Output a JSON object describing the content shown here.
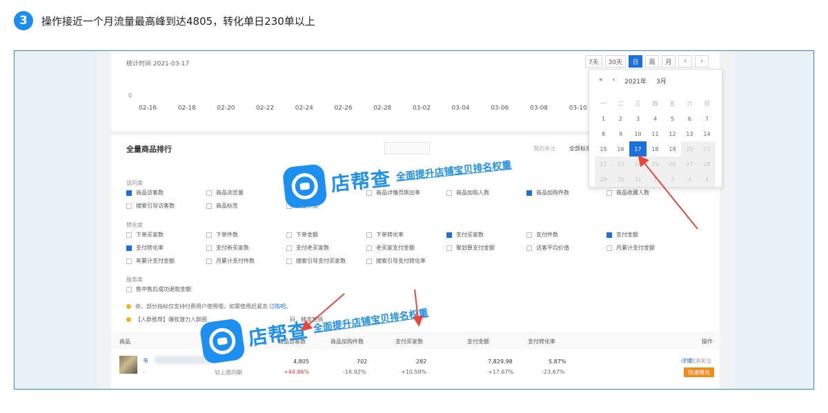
{
  "step": {
    "number": "3",
    "text": "操作接近一个月流量最高峰到达4805，转化单日230单以上"
  },
  "stats": {
    "time_label": "统计时间 2021-03-17",
    "range_buttons": [
      "7天",
      "30天",
      "日",
      "周",
      "月"
    ],
    "active_range": "日",
    "prev_icon": "‹",
    "next_icon": "›",
    "chart_zero": "0",
    "x_axis": [
      "02-16",
      "02-18",
      "02-20",
      "02-22",
      "02-24",
      "02-26",
      "02-28",
      "03-02",
      "03-04",
      "03-06",
      "03-08",
      "03-10"
    ]
  },
  "calendar": {
    "prev_year": "«",
    "prev_month": "‹",
    "year": "2021年",
    "month": "3月",
    "weekdays": [
      "一",
      "二",
      "三",
      "四",
      "五",
      "六",
      "日"
    ],
    "days": [
      {
        "d": "1",
        "s": ""
      },
      {
        "d": "2",
        "s": ""
      },
      {
        "d": "3",
        "s": ""
      },
      {
        "d": "4",
        "s": ""
      },
      {
        "d": "5",
        "s": ""
      },
      {
        "d": "6",
        "s": ""
      },
      {
        "d": "7",
        "s": ""
      },
      {
        "d": "8",
        "s": ""
      },
      {
        "d": "9",
        "s": ""
      },
      {
        "d": "10",
        "s": ""
      },
      {
        "d": "11",
        "s": ""
      },
      {
        "d": "12",
        "s": ""
      },
      {
        "d": "13",
        "s": ""
      },
      {
        "d": "14",
        "s": ""
      },
      {
        "d": "15",
        "s": ""
      },
      {
        "d": "16",
        "s": ""
      },
      {
        "d": "17",
        "s": "sel"
      },
      {
        "d": "18",
        "s": ""
      },
      {
        "d": "19",
        "s": ""
      },
      {
        "d": "20",
        "s": "dis"
      },
      {
        "d": "21",
        "s": "dis"
      },
      {
        "d": "22",
        "s": "dis"
      },
      {
        "d": "23",
        "s": "dis"
      },
      {
        "d": "24",
        "s": "dis"
      },
      {
        "d": "25",
        "s": "dis"
      },
      {
        "d": "26",
        "s": "dis"
      },
      {
        "d": "27",
        "s": "dis"
      },
      {
        "d": "28",
        "s": "dis"
      },
      {
        "d": "29",
        "s": "dis"
      },
      {
        "d": "30",
        "s": "dis"
      },
      {
        "d": "31",
        "s": "dis"
      },
      {
        "d": "1",
        "s": "dis"
      },
      {
        "d": "2",
        "s": "dis"
      },
      {
        "d": "3",
        "s": "dis"
      },
      {
        "d": "4",
        "s": "dis"
      }
    ]
  },
  "ranking": {
    "title": "全量商品排行",
    "follow_label": "我的关注",
    "all_category": "全部标准类目",
    "groups": [
      {
        "name": "访问类",
        "options": [
          {
            "label": "商品访客数",
            "checked": true
          },
          {
            "label": "商品浏览量",
            "checked": false
          },
          {
            "label": "平",
            "checked": false
          },
          {
            "label": "商品详情页跳出率",
            "checked": false
          },
          {
            "label": "商品加购人数",
            "checked": false
          },
          {
            "label": "商品加购件数",
            "checked": true
          },
          {
            "label": "商品收藏人数",
            "checked": false
          },
          {
            "label": "搜索引导访客数",
            "checked": false
          },
          {
            "label": "商品标签",
            "checked": false
          },
          {
            "label": "商品状态",
            "checked": false
          }
        ]
      },
      {
        "name": "转化类",
        "options": [
          {
            "label": "下单买家数",
            "checked": false
          },
          {
            "label": "下单件数",
            "checked": false
          },
          {
            "label": "下单金额",
            "checked": false
          },
          {
            "label": "下单转化率",
            "checked": false
          },
          {
            "label": "支付买家数",
            "checked": true
          },
          {
            "label": "支付件数",
            "checked": false
          },
          {
            "label": "支付金额",
            "checked": true
          },
          {
            "label": "支付转化率",
            "checked": true
          },
          {
            "label": "支付新买家数",
            "checked": false
          },
          {
            "label": "支付老买家数",
            "checked": false
          },
          {
            "label": "老买家支付金额",
            "checked": false
          },
          {
            "label": "聚划算支付金额",
            "checked": false
          },
          {
            "label": "访客平均价值",
            "checked": false
          },
          {
            "label": "月累计支付金额",
            "checked": false
          },
          {
            "label": "年累计支付金额",
            "checked": false
          },
          {
            "label": "月累计支付件数",
            "checked": false
          },
          {
            "label": "搜索引导支付买家数",
            "checked": false
          },
          {
            "label": "搜索引导支付转化率",
            "checked": false
          }
        ]
      },
      {
        "name": "服务类",
        "options": [
          {
            "label": "售中售后成功退款金额",
            "checked": false
          }
        ]
      }
    ],
    "note1": "亲，部分指标仅支持付费用户使用哦，如需使用赶紧去",
    "note1_link": "订购吧。",
    "note2": "【人群推荐】爆款潜力人群圈",
    "note2_tail": "码，精准营销",
    "table": {
      "headers": [
        "商品",
        "商品访客数",
        "商品加购件数",
        "支付买家数",
        "支付金额",
        "支付转化率",
        "操作"
      ],
      "row": {
        "name": "韦",
        "compare_label": "较上周同期",
        "dash": "-",
        "visitors": "4,805",
        "visitors_chg": "+44.86%",
        "cart": "702",
        "cart_chg": "-16.92%",
        "buyers": "282",
        "buyers_chg": "+10.59%",
        "amount": "7,829.98",
        "amount_chg": "+17.67%",
        "rate": "5.87%",
        "rate_chg": "-23.67%",
        "detail": "详情",
        "unfollow": "取消关注",
        "hot": "快速曝光"
      }
    }
  },
  "watermark": {
    "brand": "店帮查",
    "tagline": "全面提升店铺宝贝排名权重"
  },
  "colors": {
    "accent": "#1b8cf0",
    "arrow": "#e8453c",
    "orange": "#f38a1b"
  }
}
